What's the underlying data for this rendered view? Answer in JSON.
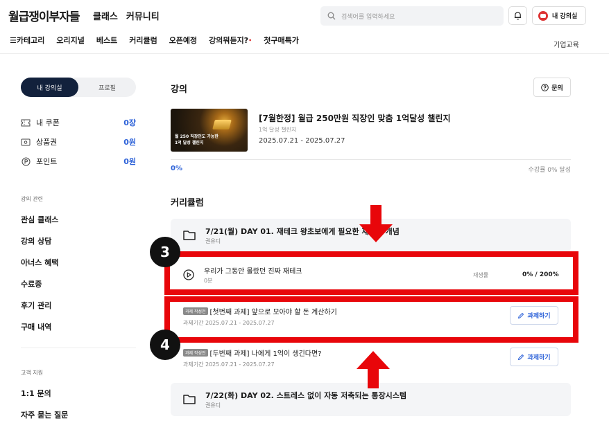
{
  "header": {
    "logo": "월급쟁이부자들",
    "topnav": [
      "클래스",
      "커뮤니티"
    ],
    "search_placeholder": "검색어를 입력하세요",
    "my_lecture_label": "내 강의실",
    "subnav": [
      "☰카테고리",
      "오리지널",
      "베스트",
      "커리큘럼",
      "오픈예정",
      "강의뭐듣지?",
      "첫구매특가"
    ],
    "subnav_dot": "•",
    "corp_edu": "기업교육"
  },
  "sidebar": {
    "toggle_active": "내 강의실",
    "toggle_inactive": "프로필",
    "wallet": [
      {
        "label": "내 쿠폰",
        "value": "0장",
        "icon": "ticket-icon"
      },
      {
        "label": "상품권",
        "value": "0원",
        "icon": "voucher-icon"
      },
      {
        "label": "포인트",
        "value": "0원",
        "icon": "point-icon"
      }
    ],
    "section_course": "강의 관련",
    "course_items": [
      "관심 클래스",
      "강의 상담",
      "아너스 혜택",
      "수료증",
      "후기 관리",
      "구매 내역"
    ],
    "section_support": "고객 지원",
    "support_items": [
      "1:1 문의",
      "자주 묻는 질문"
    ]
  },
  "main": {
    "lecture_heading": "강의",
    "inquiry_label": "문의",
    "course": {
      "thumb_caption": "월 250 직장인도 가능한\n1억 달성 챌린지",
      "title": "[7월한정] 월급 250만원 직장인 맞춤 1억달성 챌린지",
      "subtitle": "1억 달성 챌린지",
      "date": "2025.07.21 - 2025.07.27",
      "progress": "0%",
      "progress_rate": "수강률 0% 달성"
    },
    "curriculum_heading": "커리큘럼",
    "day1": {
      "title": "7/21(월) DAY 01. 재테크 왕초보에게 필요한 재테크 개념",
      "instructor": "권유디"
    },
    "lesson": {
      "title": "우리가 그동안 몰랐던 진짜 재테크",
      "duration": "0분",
      "replay_label": "재생률",
      "replay_value": "0% / 200%"
    },
    "tasks": [
      {
        "badge": "과제 작성전",
        "title": "[첫번째 과제] 앞으로 모아야 할 돈 계산하기",
        "period": "과제기간 2025.07.21 - 2025.07.27",
        "button": "과제하기"
      },
      {
        "badge": "과제 작성전",
        "title": "[두번째 과제] 나에게 1억이 생긴다면?",
        "period": "과제기간 2025.07.21 - 2025.07.27",
        "button": "과제하기"
      }
    ],
    "day2": {
      "title": "7/22(화) DAY 02. 스트레스 없이 자동 저축되는 통장시스템",
      "instructor": "권유디"
    }
  },
  "annotations": {
    "marker_3": "3",
    "marker_4": "4",
    "highlight_color": "#e8060a"
  }
}
